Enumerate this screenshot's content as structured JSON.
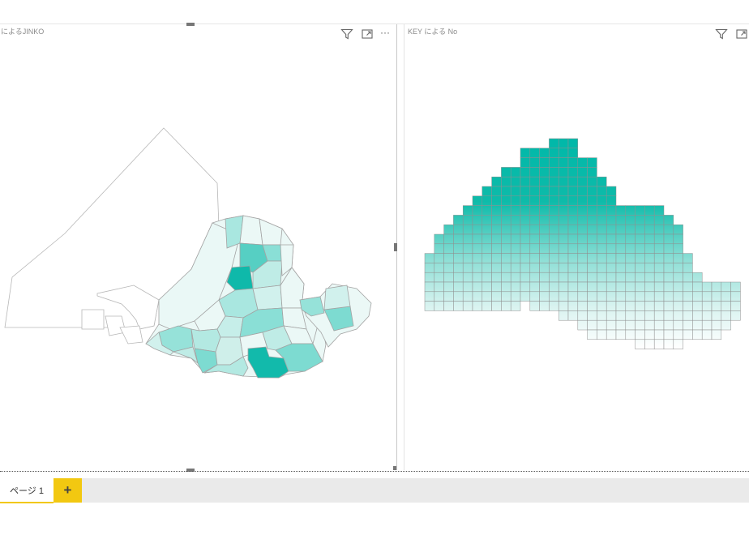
{
  "visuals": {
    "left": {
      "title": "によるJINKO",
      "icons": [
        "filter-icon",
        "focus-mode-icon",
        "more-options-icon"
      ],
      "more_label": "···"
    },
    "right": {
      "title": "KEY による No",
      "icons": [
        "filter-icon",
        "focus-mode-icon"
      ]
    }
  },
  "colors": {
    "accent": "#00b8a9",
    "tab_accent": "#f2c811",
    "outline": "#a3a3a3",
    "light_fill": "#ecf9f7"
  },
  "tabs": [
    {
      "label": "ページ 1",
      "active": true
    }
  ],
  "add_tab_label": "+"
}
